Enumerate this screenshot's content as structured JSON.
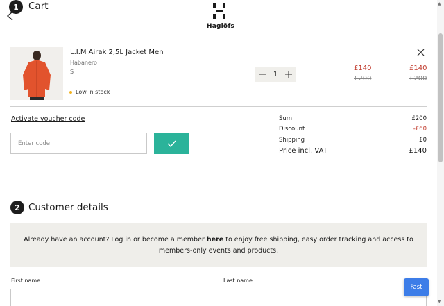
{
  "header": {
    "cart_step_number": "1",
    "cart_title": "Cart",
    "brand_name": "Haglöfs"
  },
  "cart_item": {
    "name": "L.I.M Airak 2,5L Jacket Men",
    "color": "Habanero",
    "size": "S",
    "stock_status": "Low in stock",
    "quantity": "1",
    "unit_price_now": "£140",
    "unit_price_old": "£200",
    "total_price_now": "£140",
    "total_price_old": "£200"
  },
  "voucher": {
    "link_label": "Activate voucher code",
    "placeholder": "Enter code"
  },
  "summary": {
    "rows": [
      {
        "label": "Sum",
        "value": "£200"
      },
      {
        "label": "Discount",
        "value": "-£60"
      },
      {
        "label": "Shipping",
        "value": "£0"
      },
      {
        "label": "Price incl. VAT",
        "value": "£140"
      }
    ]
  },
  "customer": {
    "step_number": "2",
    "title": "Customer details",
    "notice_pre": "Already have an account? Log in or become a member ",
    "notice_link": "here",
    "notice_post": " to enjoy free shipping, easy order tracking and access to members-only events and products.",
    "first_name_label": "First name",
    "last_name_label": "Last name"
  },
  "fast_button_label": "Fast",
  "colors": {
    "accent_green": "#2bb39a",
    "discount_red": "#c0392b",
    "fast_blue": "#3d7de8",
    "stock_yellow": "#f2b21c"
  },
  "icons": {
    "back": "chevron-left-icon",
    "remove": "close-icon",
    "confirm": "checkmark-icon",
    "brand": "haglofs-logo-icon"
  }
}
